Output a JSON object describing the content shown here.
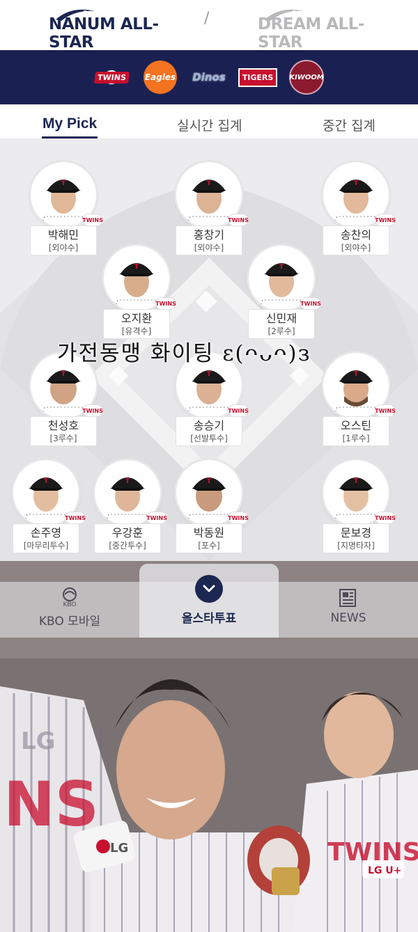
{
  "header": {
    "brand_left": "NANUM ALL-STAR",
    "brand_right": "DREAM ALL-STAR",
    "separator": "/"
  },
  "teams": [
    {
      "name": "TWINS",
      "icon": "twins-logo"
    },
    {
      "name": "Eagles",
      "icon": "eagles-logo"
    },
    {
      "name": "Dinos",
      "icon": "dinos-logo"
    },
    {
      "name": "TIGERS",
      "icon": "tigers-logo"
    },
    {
      "name": "KIWOOM",
      "icon": "kiwoom-logo"
    }
  ],
  "tabs": {
    "my_pick": "My Pick",
    "realtime": "실시간 집계",
    "interim": "중간 집계"
  },
  "players": [
    {
      "name": "박해민",
      "position": "[외야수]",
      "badge": "TWINS"
    },
    {
      "name": "홍창기",
      "position": "[외야수]",
      "badge": "TWINS"
    },
    {
      "name": "송찬의",
      "position": "[외야수]",
      "badge": "TWINS"
    },
    {
      "name": "오지환",
      "position": "[유격수]",
      "badge": "TWINS"
    },
    {
      "name": "신민재",
      "position": "[2루수]",
      "badge": "TWINS"
    },
    {
      "name": "천성호",
      "position": "[3루수]",
      "badge": "TWINS"
    },
    {
      "name": "송승기",
      "position": "[선발투수]",
      "badge": "TWINS"
    },
    {
      "name": "오스틴",
      "position": "[1루수]",
      "badge": "TWINS"
    },
    {
      "name": "손주영",
      "position": "[마무리투수]",
      "badge": "TWINS"
    },
    {
      "name": "우강훈",
      "position": "[중간투수]",
      "badge": "TWINS"
    },
    {
      "name": "박동원",
      "position": "[포수]",
      "badge": "TWINS"
    },
    {
      "name": "문보경",
      "position": "[지명타자]",
      "badge": "TWINS"
    }
  ],
  "overlay": {
    "slogan": "가전동맹 화이팅 ε(ᴖᴗᴖ)з"
  },
  "bottom_nav": {
    "kbo_mobile": "KBO 모바일",
    "kbo_small": "KBO",
    "allstar_vote": "올스타투표",
    "news": "NEWS"
  },
  "photo": {
    "jersey_text": "LG",
    "jersey_text2": "TWINS",
    "sponsor": "LG U+"
  },
  "colors": {
    "navy": "#1c2752",
    "team_strip": "#1a2152",
    "twins_red": "#c8102e",
    "field_bg": "#ececee"
  }
}
